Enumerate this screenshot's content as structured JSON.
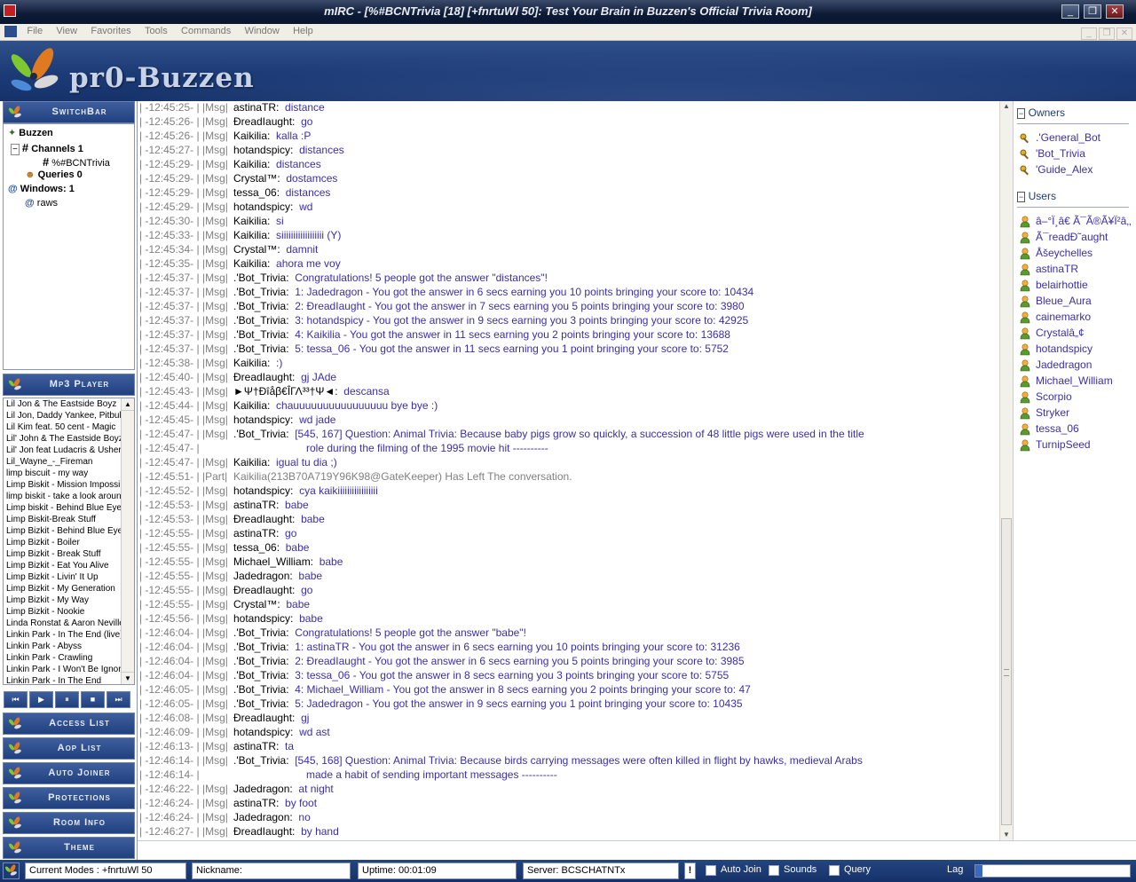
{
  "window": {
    "title": "mIRC - [%#BCNTrivia [18] [+fnrtuWl 50]: Test Your Brain in Buzzen's Official Trivia Room]"
  },
  "menu": [
    {
      "label": "File"
    },
    {
      "label": "View"
    },
    {
      "label": "Favorites"
    },
    {
      "label": "Tools"
    },
    {
      "label": "Commands"
    },
    {
      "label": "Window"
    },
    {
      "label": "Help"
    }
  ],
  "banner": {
    "logo_text": "pr0-Buzzen"
  },
  "sidebar": {
    "switchbar_label": "SwitchBar",
    "tree": {
      "root": "Buzzen",
      "channels": "Channels 1",
      "channel": "%#BCNTrivia",
      "queries": "Queries 0",
      "windows": "Windows: 1",
      "raws": "raws"
    },
    "mp3_label": "Mp3 Player",
    "songs": [
      "Lil Jon & The Eastside Boyz",
      "Lil Jon, Daddy Yankee, Pitbull",
      "Lil Kim feat. 50 cent - Magic",
      "Lil' John & The Eastside Boyz",
      "Lil' Jon feat Ludacris & Usher",
      "Lil_Wayne_-_Fireman",
      "limp biscuit - my way",
      "Limp Biskit - Mission Impossible",
      "limp biskit - take a look around",
      "Limp biskit - Behind Blue Eyes",
      "Limp Biskit-Break Stuff",
      "Limp Bizkit - Behind Blue Eyes",
      "Limp Bizkit - Boiler",
      "Limp Bizkit - Break Stuff",
      "Limp Bizkit - Eat You Alive",
      "Limp Bizkit - Livin' It Up",
      "Limp Bizkit - My Generation",
      "Limp Bizkit - My Way",
      "Limp Bizkit - Nookie",
      "Linda Ronstat & Aaron Neville",
      "Linkin Park - In The End (live)",
      "Linkin Park - Abyss",
      "Linkin Park - Crawling",
      "Linkin Park - I Won't Be Ignored",
      "Linkin Park - In The End"
    ],
    "player_buttons": [
      "⏮",
      "▶",
      "⏸",
      "■",
      "⏭"
    ],
    "sections": [
      "Access List",
      "Aop List",
      "Auto Joiner",
      "Protections",
      "Room Info",
      "Theme"
    ]
  },
  "chat": [
    {
      "ts": "| -12:45:25- |",
      "tag": "|Msg|",
      "nick": "astinaTR:",
      "msg": "distance"
    },
    {
      "ts": "| -12:45:26- |",
      "tag": "|Msg|",
      "nick": "ÐreadIaught:",
      "msg": "go"
    },
    {
      "ts": "| -12:45:26- |",
      "tag": "|Msg|",
      "nick": "Kaikilia:",
      "msg": "kalla :P"
    },
    {
      "ts": "| -12:45:27- |",
      "tag": "|Msg|",
      "nick": "hotandspicy:",
      "msg": "distances"
    },
    {
      "ts": "| -12:45:29- |",
      "tag": "|Msg|",
      "nick": "Kaikilia:",
      "msg": "distances"
    },
    {
      "ts": "| -12:45:29- |",
      "tag": "|Msg|",
      "nick": "Crystal™:",
      "msg": "dostamces"
    },
    {
      "ts": "| -12:45:29- |",
      "tag": "|Msg|",
      "nick": "tessa_06:",
      "msg": "distances"
    },
    {
      "ts": "| -12:45:29- |",
      "tag": "|Msg|",
      "nick": "hotandspicy:",
      "msg": "wd"
    },
    {
      "ts": "| -12:45:30- |",
      "tag": "|Msg|",
      "nick": "Kaikilia:",
      "msg": "si"
    },
    {
      "ts": "| -12:45:33- |",
      "tag": "|Msg|",
      "nick": "Kaikilia:",
      "msg": "siiiiiiiiiiiiiiiiii (Y)"
    },
    {
      "ts": "| -12:45:34- |",
      "tag": "|Msg|",
      "nick": "Crystal™:",
      "msg": "damnit"
    },
    {
      "ts": "| -12:45:35- |",
      "tag": "|Msg|",
      "nick": "Kaikilia:",
      "msg": "ahora me voy"
    },
    {
      "ts": "| -12:45:37- |",
      "tag": "|Msg|",
      "nick": ".'Bot_Trivia:",
      "msg": "Congratulations! 5 people got the answer \"distances\"!"
    },
    {
      "ts": "| -12:45:37- |",
      "tag": "|Msg|",
      "nick": ".'Bot_Trivia:",
      "msg": "1: Jadedragon - You got the answer in 6 secs earning you 10 points bringing your score to: 10434"
    },
    {
      "ts": "| -12:45:37- |",
      "tag": "|Msg|",
      "nick": ".'Bot_Trivia:",
      "msg": "2: ÐreadIaught - You got the answer in 7 secs earning you 5 points bringing your score to: 3980"
    },
    {
      "ts": "| -12:45:37- |",
      "tag": "|Msg|",
      "nick": ".'Bot_Trivia:",
      "msg": "3: hotandspicy - You got the answer in 9 secs earning you 3 points bringing your score to: 42925"
    },
    {
      "ts": "| -12:45:37- |",
      "tag": "|Msg|",
      "nick": ".'Bot_Trivia:",
      "msg": "4: Kaikilia - You got the answer in 11 secs earning you 2 points bringing your score to: 13688"
    },
    {
      "ts": "| -12:45:37- |",
      "tag": "|Msg|",
      "nick": ".'Bot_Trivia:",
      "msg": "5: tessa_06 - You got the answer in 11 secs earning you 1 point bringing your score to: 5752"
    },
    {
      "ts": "| -12:45:38- |",
      "tag": "|Msg|",
      "nick": "Kaikilia:",
      "msg": ":)"
    },
    {
      "ts": "| -12:45:40- |",
      "tag": "|Msg|",
      "nick": "ÐreadIaught:",
      "msg": "gj JAde"
    },
    {
      "ts": "| -12:45:43- |",
      "tag": "|Msg|",
      "nick": "►Ψ†Ðîåβ€ÎΓΛ³³†Ψ◄:",
      "msg": "descansa"
    },
    {
      "ts": "| -12:45:44- |",
      "tag": "|Msg|",
      "nick": "Kaikilia:",
      "msg": "chauuuuuuuuuuuuuuuu bye bye :)"
    },
    {
      "ts": "| -12:45:45- |",
      "tag": "|Msg|",
      "nick": "hotandspicy:",
      "msg": "wd jade"
    },
    {
      "ts": "| -12:45:47- |",
      "tag": "|Msg|",
      "nick": ".'Bot_Trivia:",
      "msg": "[545, 167] Question: Animal Trivia: Because baby pigs grow so quickly, a succession of 48 little pigs were used in the title"
    },
    {
      "ts": "| -12:45:47- |",
      "tag": "",
      "nick": "",
      "msg": "role during the filming of the 1995 movie hit ----------",
      "cont": true
    },
    {
      "ts": "| -12:45:47- |",
      "tag": "|Msg|",
      "nick": "Kaikilia:",
      "msg": "igual tu dia ;)"
    },
    {
      "ts": "| -12:45:51- |",
      "tag": "|Part|",
      "nick": "",
      "msg": "Kaikilia(213B70A719Y96K98@GateKeeper) Has Left The conversation.",
      "part": true
    },
    {
      "ts": "| -12:45:52- |",
      "tag": "|Msg|",
      "nick": "hotandspicy:",
      "msg": "cya kaikiiiiiiiiiiiiiiiii"
    },
    {
      "ts": "| -12:45:53- |",
      "tag": "|Msg|",
      "nick": "astinaTR:",
      "msg": "babe"
    },
    {
      "ts": "| -12:45:53- |",
      "tag": "|Msg|",
      "nick": "ÐreadIaught:",
      "msg": "babe"
    },
    {
      "ts": "| -12:45:55- |",
      "tag": "|Msg|",
      "nick": "astinaTR:",
      "msg": "go"
    },
    {
      "ts": "| -12:45:55- |",
      "tag": "|Msg|",
      "nick": "tessa_06:",
      "msg": "babe"
    },
    {
      "ts": "| -12:45:55- |",
      "tag": "|Msg|",
      "nick": "Michael_William:",
      "msg": "babe"
    },
    {
      "ts": "| -12:45:55- |",
      "tag": "|Msg|",
      "nick": "Jadedragon:",
      "msg": "babe"
    },
    {
      "ts": "| -12:45:55- |",
      "tag": "|Msg|",
      "nick": "ÐreadIaught:",
      "msg": "go"
    },
    {
      "ts": "| -12:45:55- |",
      "tag": "|Msg|",
      "nick": "Crystal™:",
      "msg": "babe"
    },
    {
      "ts": "| -12:45:56- |",
      "tag": "|Msg|",
      "nick": "hotandspicy:",
      "msg": "babe"
    },
    {
      "ts": "| -12:46:04- |",
      "tag": "|Msg|",
      "nick": ".'Bot_Trivia:",
      "msg": "Congratulations! 5 people got the answer \"babe\"!"
    },
    {
      "ts": "| -12:46:04- |",
      "tag": "|Msg|",
      "nick": ".'Bot_Trivia:",
      "msg": "1: astinaTR - You got the answer in 6 secs earning you 10 points bringing your score to: 31236"
    },
    {
      "ts": "| -12:46:04- |",
      "tag": "|Msg|",
      "nick": ".'Bot_Trivia:",
      "msg": "2: ÐreadIaught - You got the answer in 6 secs earning you 5 points bringing your score to: 3985"
    },
    {
      "ts": "| -12:46:04- |",
      "tag": "|Msg|",
      "nick": ".'Bot_Trivia:",
      "msg": "3: tessa_06 - You got the answer in 8 secs earning you 3 points bringing your score to: 5755"
    },
    {
      "ts": "| -12:46:05- |",
      "tag": "|Msg|",
      "nick": ".'Bot_Trivia:",
      "msg": "4: Michael_William - You got the answer in 8 secs earning you 2 points bringing your score to: 47"
    },
    {
      "ts": "| -12:46:05- |",
      "tag": "|Msg|",
      "nick": ".'Bot_Trivia:",
      "msg": "5: Jadedragon - You got the answer in 9 secs earning you 1 point bringing your score to: 10435"
    },
    {
      "ts": "| -12:46:08- |",
      "tag": "|Msg|",
      "nick": "ÐreadIaught:",
      "msg": "gj"
    },
    {
      "ts": "| -12:46:09- |",
      "tag": "|Msg|",
      "nick": "hotandspicy:",
      "msg": "wd ast"
    },
    {
      "ts": "| -12:46:13- |",
      "tag": "|Msg|",
      "nick": "astinaTR:",
      "msg": "ta"
    },
    {
      "ts": "| -12:46:14- |",
      "tag": "|Msg|",
      "nick": ".'Bot_Trivia:",
      "msg": "[545, 168] Question: Animal Trivia: Because birds carrying messages were often killed in flight by hawks, medieval Arabs"
    },
    {
      "ts": "| -12:46:14- |",
      "tag": "",
      "nick": "",
      "msg": "made a habit of sending important messages ----------",
      "cont": true
    },
    {
      "ts": "| -12:46:22- |",
      "tag": "|Msg|",
      "nick": "Jadedragon:",
      "msg": "at night"
    },
    {
      "ts": "| -12:46:24- |",
      "tag": "|Msg|",
      "nick": "astinaTR:",
      "msg": "by foot"
    },
    {
      "ts": "| -12:46:24- |",
      "tag": "|Msg|",
      "nick": "Jadedragon:",
      "msg": "no"
    },
    {
      "ts": "| -12:46:27- |",
      "tag": "|Msg|",
      "nick": "ÐreadIaught:",
      "msg": "by hand"
    }
  ],
  "nicklist": {
    "owners_label": "Owners",
    "owners": [
      ".'General_Bot",
      "'Bot_Trivia",
      "'Guide_Alex"
    ],
    "users_label": "Users",
    "users": [
      "â–°Ï¸â€ Ã¯Ã®Ã¥Ï²â‚‚",
      "Ã¯readÐ˜aught",
      "Åšeychelles",
      "astinaTR",
      "belairhottie",
      "Bleue_Aura",
      "cainemarko",
      "Crystalâ„¢",
      "hotandspicy",
      "Jadedragon",
      "Michael_William",
      "Scorpio",
      "Stryker",
      "tessa_06",
      "TurnipSeed"
    ]
  },
  "status": {
    "modes": "Current Modes : +fnrtuWl 50",
    "nickname": "Nickname:",
    "uptime": "Uptime: 00:01:09",
    "server": "Server: BCSCHATNTx",
    "auto_join": "Auto Join",
    "sounds": "Sounds",
    "query": "Query",
    "lag": "Lag"
  },
  "colors": {
    "accent": "#1c3b76",
    "message": "#3a2fa8",
    "timestamp": "#7f7f7f"
  }
}
